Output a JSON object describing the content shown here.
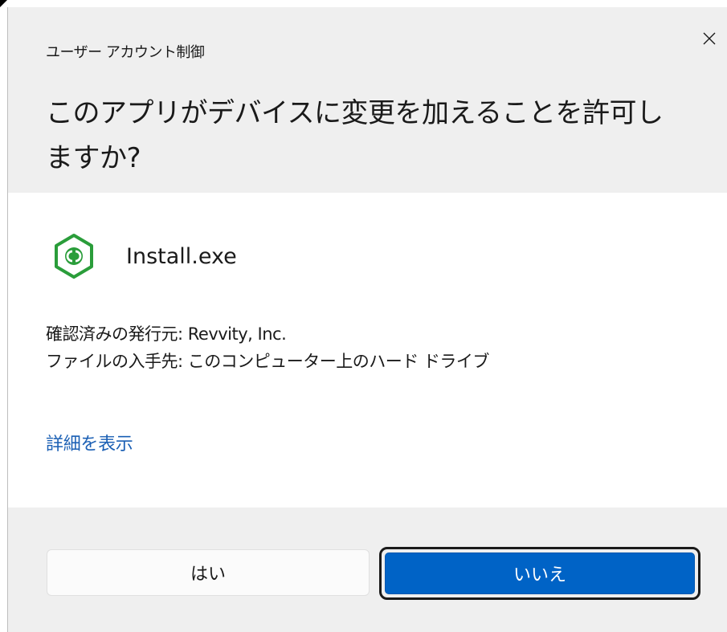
{
  "header": {
    "title": "ユーザー アカウント制御",
    "question": "このアプリがデバイスに変更を加えることを許可しますか?",
    "close_icon": "close-icon"
  },
  "app": {
    "icon": "app-logo-icon",
    "accent_color": "#2a9d3a",
    "name": "Install.exe"
  },
  "info": {
    "publisher": "確認済みの発行元: Revvity, Inc.",
    "origin": "ファイルの入手先: このコンピューター上のハード ドライブ"
  },
  "details_link": "詳細を表示",
  "buttons": {
    "yes_label": "はい",
    "no_label": "いいえ"
  },
  "colors": {
    "header_bg": "#efefef",
    "link": "#1a5fb4",
    "primary_button": "#0063c6"
  }
}
